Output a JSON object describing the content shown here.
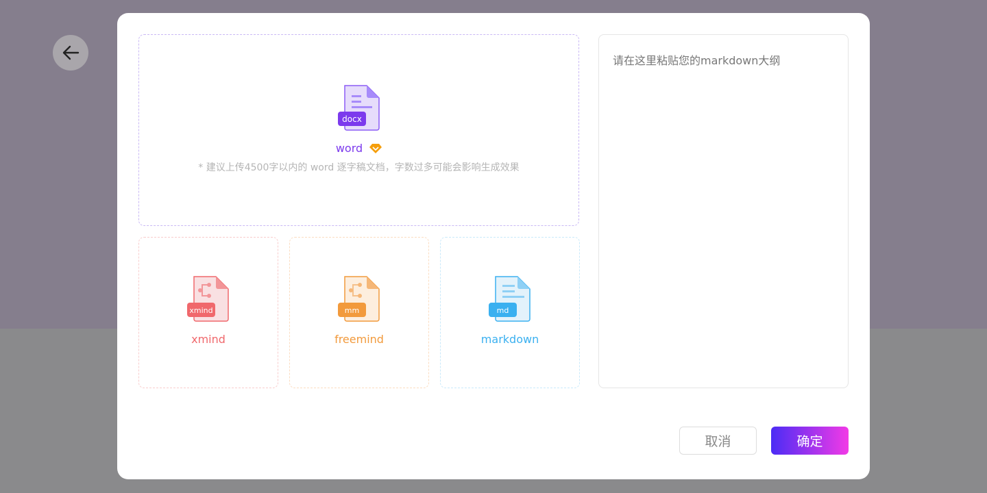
{
  "back": {
    "icon": "arrow-left-icon"
  },
  "word": {
    "badge": "docx",
    "label": "word",
    "hint": "* 建议上传4500字以内的 word 逐字稿文档，字数过多可能会影响生成效果",
    "color": "#7c3aed"
  },
  "cards": [
    {
      "badge": "xmind",
      "label": "xmind",
      "color": "#f0686c"
    },
    {
      "badge": "mm",
      "label": "freemind",
      "color": "#f29a3c"
    },
    {
      "badge": "md",
      "label": "markdown",
      "color": "#3ab0f0"
    }
  ],
  "textarea": {
    "placeholder": "请在这里粘贴您的markdown大纲"
  },
  "buttons": {
    "cancel": "取消",
    "confirm": "确定"
  }
}
